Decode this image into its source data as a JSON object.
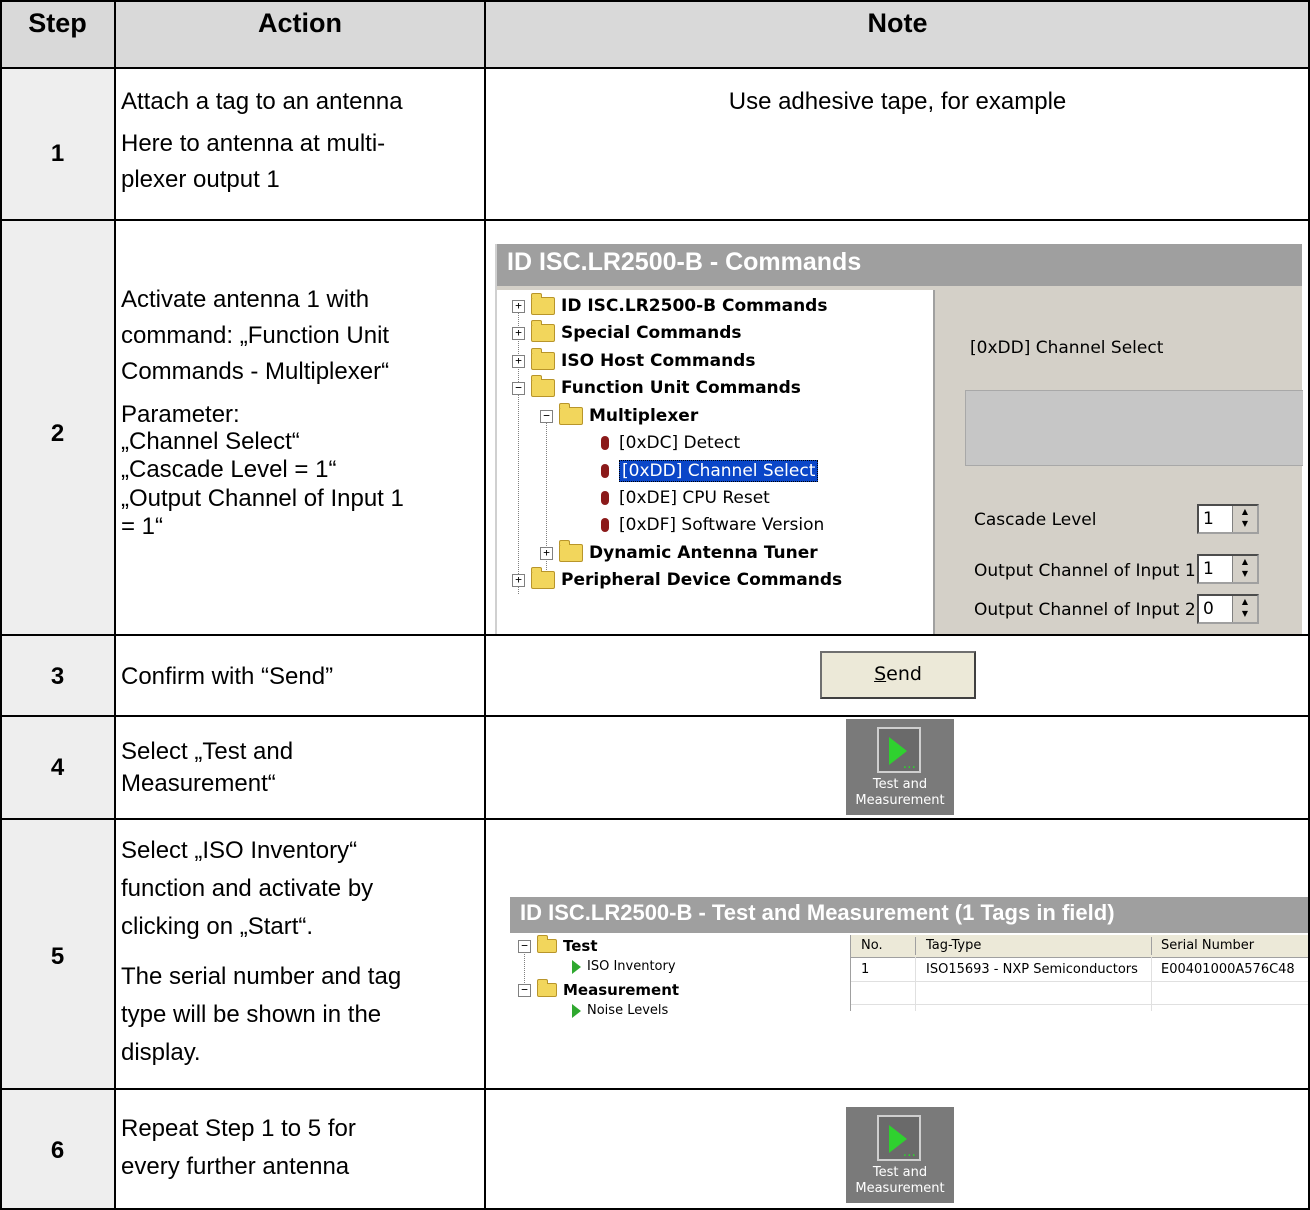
{
  "headers": {
    "step": "Step",
    "action": "Action",
    "note": "Note"
  },
  "rows": [
    {
      "step": "1",
      "action": [
        "Attach a tag to an antenna",
        "Here to antenna at multi-",
        "plexer output 1"
      ],
      "note": "Use adhesive tape, for example"
    },
    {
      "step": "2",
      "action_a": [
        "Activate antenna 1 with",
        "command: „Function Unit",
        "Commands -  Multiplexer“"
      ],
      "action_b": [
        "Parameter:",
        "„Channel Select“",
        "„Cascade Level = 1“",
        "„Output Channel of Input 1",
        "= 1“"
      ]
    },
    {
      "step": "3",
      "action": "Confirm with “Send”",
      "send_label": "Send"
    },
    {
      "step": "4",
      "action": [
        "Select „Test and",
        "Measurement“"
      ]
    },
    {
      "step": "5",
      "action_a": [
        "Select „ISO Inventory“",
        "function and activate by",
        "clicking on „Start“."
      ],
      "action_b": [
        "The serial number and tag",
        "type will be shown in the",
        "display."
      ]
    },
    {
      "step": "6",
      "action": [
        "Repeat Step 1 to 5 for",
        "every further antenna"
      ]
    }
  ],
  "commands_window": {
    "title": "ID ISC.LR2500-B - Commands",
    "tree": [
      "ID ISC.LR2500-B Commands",
      "Special Commands",
      "ISO Host Commands",
      "Function Unit Commands",
      "Multiplexer",
      "[0xDC] Detect",
      "[0xDD] Channel Select",
      "[0xDE] CPU Reset",
      "[0xDF] Software Version",
      "Dynamic Antenna Tuner",
      "Peripheral Device Commands"
    ],
    "selected_command": "[0xDD] Channel Select",
    "params": [
      {
        "label": "Cascade Level",
        "value": "1"
      },
      {
        "label": "Output Channel of Input 1",
        "value": "1"
      },
      {
        "label": "Output Channel of Input 2",
        "value": "0"
      }
    ]
  },
  "tm_button": {
    "line1": "Test and",
    "line2": "Measurement",
    "icon": "play-icon"
  },
  "tm_window": {
    "title": "ID ISC.LR2500-B - Test and Measurement  (1 Tags in field)",
    "tree": [
      "Test",
      "ISO Inventory",
      "Measurement",
      "Noise Levels"
    ],
    "columns": [
      "No.",
      "Tag-Type",
      "Serial Number"
    ],
    "rows": [
      [
        "1",
        "ISO15693 - NXP Semiconductors",
        "E00401000A576C48"
      ]
    ]
  }
}
